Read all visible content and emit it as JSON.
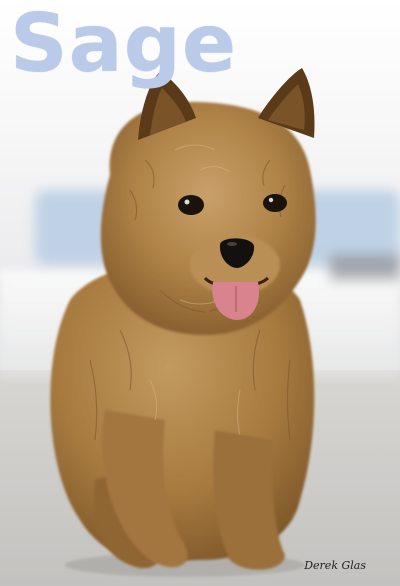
{
  "image": {
    "title": "Sage",
    "signature": "Derek Glas",
    "subject_icon": "terrier-dog-photo",
    "colors": {
      "title": "#b9cbe8",
      "fur": "#b58a4f",
      "fur_dark": "#7a5428",
      "background": "#ecedee"
    }
  }
}
